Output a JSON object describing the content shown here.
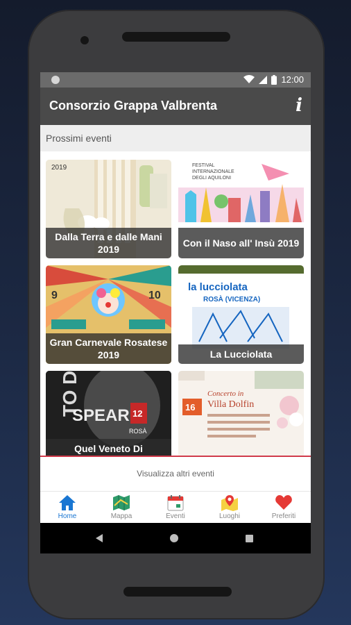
{
  "status_bar": {
    "time": "12:00"
  },
  "app_bar": {
    "title": "Consorzio Grappa Valbrenta",
    "info_icon": "info-icon"
  },
  "section": {
    "title": "Prossimi eventi"
  },
  "events": [
    {
      "title": "Dalla Terra e dalle Mani 2019"
    },
    {
      "title": "Con il Naso all' Insù 2019"
    },
    {
      "title": "Gran Carnevale Rosatese 2019"
    },
    {
      "title": "La Lucciolata"
    },
    {
      "title": "Quel Veneto Di"
    },
    {
      "title": ""
    }
  ],
  "more_button": {
    "label": "Visualizza altri eventi"
  },
  "bottom_nav": [
    {
      "label": "Home",
      "icon": "home-icon",
      "active": true
    },
    {
      "label": "Mappa",
      "icon": "map-icon",
      "active": false
    },
    {
      "label": "Eventi",
      "icon": "calendar-icon",
      "active": false
    },
    {
      "label": "Luoghi",
      "icon": "location-icon",
      "active": false
    },
    {
      "label": "Preferiti",
      "icon": "heart-icon",
      "active": false
    }
  ],
  "colors": {
    "accent": "#1976d2",
    "appbar": "#4a4a4a",
    "divider": "#d03a4a",
    "heart": "#e53935"
  }
}
